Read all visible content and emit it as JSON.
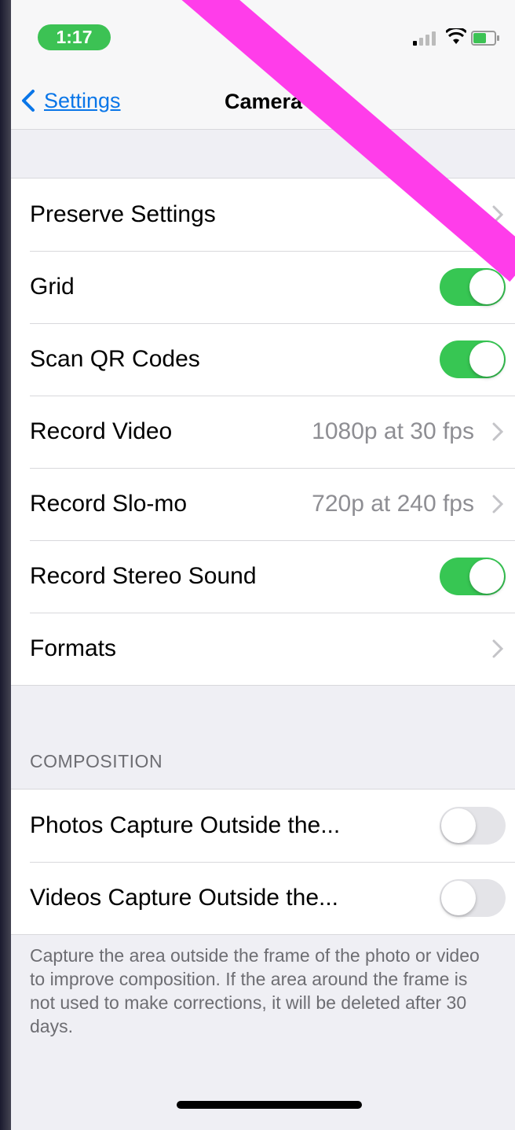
{
  "status_bar": {
    "time": "1:17"
  },
  "nav": {
    "back_label": "Settings",
    "title": "Camera"
  },
  "settings": {
    "preserve": {
      "label": "Preserve Settings"
    },
    "grid": {
      "label": "Grid",
      "on": true
    },
    "scan_qr": {
      "label": "Scan QR Codes",
      "on": true
    },
    "record_video": {
      "label": "Record Video",
      "value": "1080p at 30 fps"
    },
    "record_slomo": {
      "label": "Record Slo-mo",
      "value": "720p at 240 fps"
    },
    "stereo": {
      "label": "Record Stereo Sound",
      "on": true
    },
    "formats": {
      "label": "Formats"
    }
  },
  "composition": {
    "header": "COMPOSITION",
    "photos": {
      "label": "Photos Capture Outside the...",
      "on": false
    },
    "videos": {
      "label": "Videos Capture Outside the...",
      "on": false
    },
    "footer": "Capture the area outside the frame of the photo or video to improve composition. If the area around the frame is not used to make corrections, it will be deleted after 30 days."
  },
  "colors": {
    "accent": "#0a76e8",
    "toggle_on": "#37c653",
    "toggle_off": "#e4e4e8",
    "annotation": "#ff3dea"
  },
  "icons": [
    "back-chevron-icon",
    "chevron-right-icon",
    "signal-icon",
    "wifi-icon",
    "battery-icon"
  ]
}
